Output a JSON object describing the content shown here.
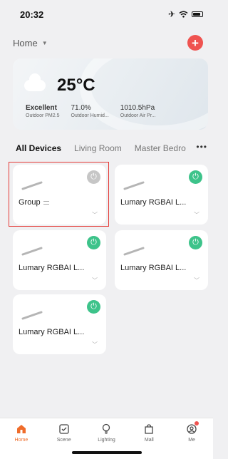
{
  "status": {
    "time": "20:32"
  },
  "header": {
    "home_label": "Home"
  },
  "weather": {
    "temperature": "25°C",
    "metrics": [
      {
        "value": "Excellent",
        "label": "Outdoor PM2.5"
      },
      {
        "value": "71.0%",
        "label": "Outdoor Humid..."
      },
      {
        "value": "1010.5hPa",
        "label": "Outdoor Air Pr..."
      }
    ]
  },
  "rooms": {
    "tabs": [
      "All Devices",
      "Living Room",
      "Master Bedro"
    ],
    "more": "•••"
  },
  "devices": [
    {
      "name": "Group",
      "power": "off"
    },
    {
      "name": "Lumary RGBAI L...",
      "power": "on"
    },
    {
      "name": "Lumary RGBAI L...",
      "power": "on"
    },
    {
      "name": "Lumary RGBAI L...",
      "power": "on"
    },
    {
      "name": "Lumary RGBAI L...",
      "power": "on"
    }
  ],
  "tabbar": {
    "items": [
      {
        "label": "Home",
        "icon": "home-icon"
      },
      {
        "label": "Scene",
        "icon": "scene-icon"
      },
      {
        "label": "Lighting",
        "icon": "bulb-icon"
      },
      {
        "label": "Mall",
        "icon": "bag-icon"
      },
      {
        "label": "Me",
        "icon": "profile-icon"
      }
    ]
  },
  "colors": {
    "accent": "#ef6c2a",
    "power_on": "#3dc38a",
    "add": "#ef5350",
    "selection": "#e53935"
  }
}
